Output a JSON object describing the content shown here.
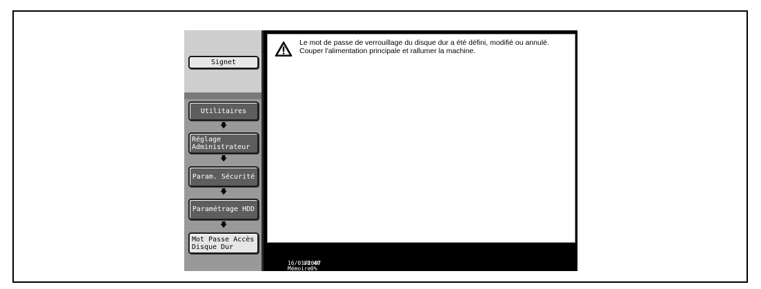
{
  "sidebar": {
    "bookmark_label": "Signet",
    "breadcrumb": [
      {
        "label": "Utilitaires"
      },
      {
        "label": "Réglage\nAdministrateur"
      },
      {
        "label": "Param. Sécurité"
      },
      {
        "label": "Paramétrage HDD"
      },
      {
        "label": "Mot Passe Accès\nDisque Dur"
      }
    ],
    "arrow_glyph": "🡇"
  },
  "dialog": {
    "icon": "warning-icon",
    "message": "Le mot de passe de verrouillage du disque dur a été défini, modifié ou annulé. Couper l'alimentation principale et rallumer la machine."
  },
  "status_bar": {
    "date": "16/01/2007",
    "time": "08:40",
    "memory_label": "Mémoire",
    "memory_value": "0%"
  },
  "colors": {
    "screen_bg": "#000000",
    "panel_bg": "#ffffff",
    "sidebar_dark": "#555555",
    "sidebar_light": "#e6e6e6"
  }
}
